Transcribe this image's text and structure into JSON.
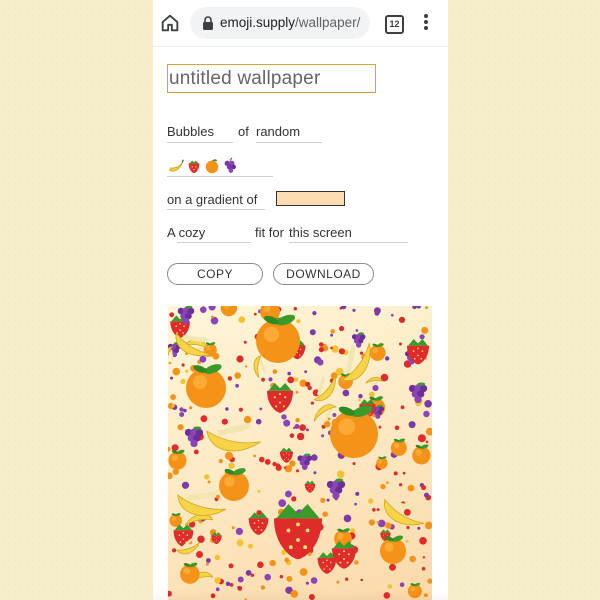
{
  "browser": {
    "url_host": "emoji.supply",
    "url_path": "/wallpaper/",
    "tab_count": "12"
  },
  "form": {
    "title_value": "untitled wallpaper",
    "shape_value": "Bubbles",
    "of_label": "of",
    "arrangement_value": "random",
    "emojis": [
      "banana",
      "strawberry",
      "tangerine",
      "grapes"
    ],
    "gradient_label": "on a gradient of",
    "gradient_color": "#fcdcb1",
    "size_value": "A cozy",
    "fit_label": "fit for",
    "screen_value": "this screen"
  },
  "buttons": {
    "copy_label": "COPY",
    "download_label": "DOWNLOAD"
  },
  "preview": {
    "emoji_types": [
      "tangerine",
      "strawberry",
      "grapes",
      "banana"
    ],
    "gradient_from": "#fff6d8",
    "gradient_to": "#fbd9a9"
  },
  "colors": {
    "page_background": "#f6eecb",
    "title_border": "#d3a83a"
  }
}
